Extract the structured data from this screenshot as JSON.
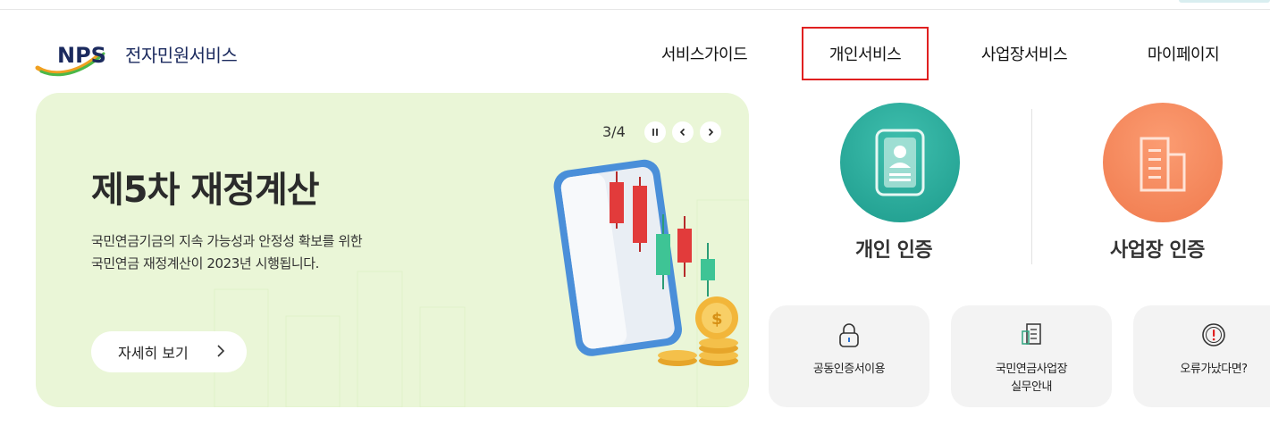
{
  "header": {
    "logo_text": "NPS",
    "service_name": "전자민원서비스",
    "nav": [
      {
        "label": "서비스가이드"
      },
      {
        "label": "개인서비스",
        "active": true
      },
      {
        "label": "사업장서비스"
      },
      {
        "label": "마이페이지"
      }
    ]
  },
  "banner": {
    "title": "제5차 재정계산",
    "desc_line1": "국민연금기금의 지속 가능성과 안정성 확보를 위한",
    "desc_line2": "국민연금 재정계산이 2023년 시행됩니다.",
    "button_label": "자세히 보기",
    "slide_counter": "3/4",
    "background_color": "#eaf6d7"
  },
  "auth": {
    "personal_label": "개인 인증",
    "business_label": "사업장 인증",
    "personal_color": "#26a896",
    "business_color": "#f5845a"
  },
  "quick_links": [
    {
      "label": "공동인증서이용",
      "icon": "lock-icon"
    },
    {
      "label_line1": "국민연금사업장",
      "label_line2": "실무안내",
      "icon": "document-list-icon"
    },
    {
      "label": "오류가났다면?",
      "icon": "alert-circle-icon"
    }
  ],
  "accent_colors": {
    "highlight_border": "#e02020",
    "brand_navy": "#1b2a5e"
  }
}
